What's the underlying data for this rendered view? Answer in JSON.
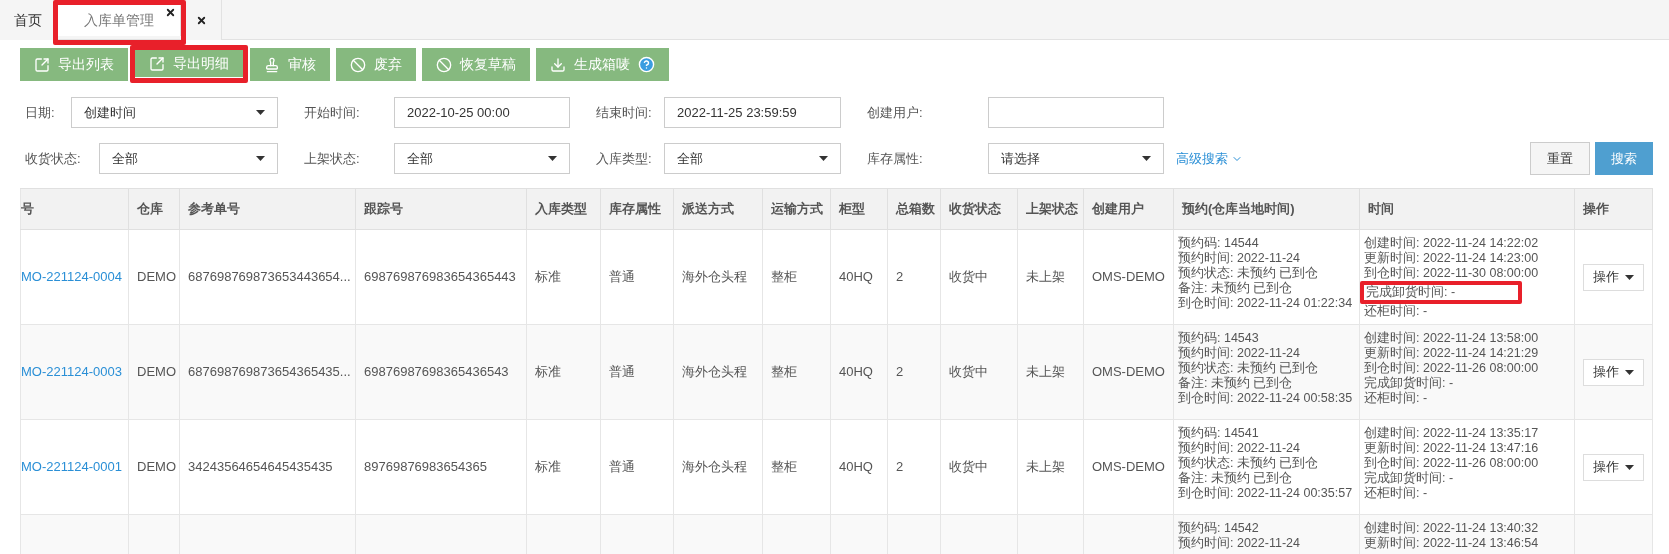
{
  "tabs": [
    {
      "label": "首页",
      "selected": false,
      "closable": false,
      "highlighted": false
    },
    {
      "label": "入库单管理",
      "selected": true,
      "closable": true,
      "highlighted": true
    },
    {
      "selected": false,
      "closable": true,
      "highlighted": false
    }
  ],
  "toolbar": [
    {
      "label": "导出列表",
      "kind": "export",
      "help": false,
      "highlighted": false
    },
    {
      "label": "导出明细",
      "kind": "export",
      "help": false,
      "highlighted": true
    },
    {
      "label": "审核",
      "kind": "stamp",
      "help": false,
      "highlighted": false
    },
    {
      "label": "废弃",
      "kind": "ban",
      "help": false,
      "highlighted": false
    },
    {
      "label": "恢复草稿",
      "kind": "ban",
      "help": false,
      "highlighted": false
    },
    {
      "label": "生成箱唛",
      "kind": "download",
      "help": true,
      "highlighted": false
    }
  ],
  "filters": [
    [
      {
        "label": "日期:",
        "kind": "select",
        "value": "创建时间"
      },
      {
        "label": "开始时间:",
        "kind": "input",
        "value": "2022-10-25 00:00"
      },
      {
        "label": "结束时间:",
        "kind": "input",
        "value": "2022-11-25 23:59:59"
      },
      {
        "label": "创建用户:",
        "kind": "input"
      }
    ],
    [
      {
        "label": "收货状态:",
        "kind": "select",
        "value": "全部"
      },
      {
        "label": "上架状态:",
        "kind": "select",
        "value": "全部"
      },
      {
        "label": "入库类型:",
        "kind": "select",
        "value": "全部"
      },
      {
        "label": "库存属性:",
        "kind": "select",
        "value": "请选择"
      }
    ]
  ],
  "advanced_search": "高级搜索",
  "reset_button": "重置",
  "search_button": "搜索",
  "table": {
    "columns": [
      "号",
      "仓库",
      "参考单号",
      "跟踪号",
      "入库类型",
      "库存属性",
      "派送方式",
      "运输方式",
      "柜型",
      "总箱数",
      "收货状态",
      "上架状态",
      "创建用户",
      "预约(仓库当地时间)",
      "时间",
      "操作"
    ],
    "rows": [
      {
        "order_no": "MO-221124-0004",
        "warehouse": "DEMO",
        "ref_no": "687698769873653443654...",
        "tracking_no": "698769876983654365443",
        "inbound_type": "标准",
        "stock_attr": "普通",
        "delivery": "海外仓头程",
        "transport": "整柜",
        "container": "40HQ",
        "boxes": "2",
        "receive_status": "收货中",
        "shelf_status": "未上架",
        "creator": "OMS-DEMO",
        "booking": [
          "预约码: 14544",
          "预约时间: 2022-11-24",
          "预约状态: 未预约 已到仓",
          "备注: 未预约 已到仓",
          "到仓时间: 2022-11-24 01:22:34"
        ],
        "times": [
          "创建时间: 2022-11-24 14:22:02",
          "更新时间: 2022-11-24 14:23:00",
          "到仓时间: 2022-11-30 08:00:00",
          {
            "text": "完成卸货时间: -",
            "highlighted": true
          },
          "还柜时间: -"
        ],
        "action": "操作"
      },
      {
        "order_no": "MO-221124-0003",
        "warehouse": "DEMO",
        "ref_no": "687698769873654365435...",
        "tracking_no": "69876987698365436543",
        "inbound_type": "标准",
        "stock_attr": "普通",
        "delivery": "海外仓头程",
        "transport": "整柜",
        "container": "40HQ",
        "boxes": "2",
        "receive_status": "收货中",
        "shelf_status": "未上架",
        "creator": "OMS-DEMO",
        "booking": [
          "预约码: 14543",
          "预约时间: 2022-11-24",
          "预约状态: 未预约 已到仓",
          "备注: 未预约 已到仓",
          "到仓时间: 2022-11-24 00:58:35"
        ],
        "times": [
          "创建时间: 2022-11-24 13:58:00",
          "更新时间: 2022-11-24 14:21:29",
          "到仓时间: 2022-11-26 08:00:00",
          "完成卸货时间: -",
          "还柜时间: -"
        ],
        "action": "操作"
      },
      {
        "order_no": "MO-221124-0001",
        "warehouse": "DEMO",
        "ref_no": "34243564654645435435",
        "tracking_no": "89769876983654365",
        "inbound_type": "标准",
        "stock_attr": "普通",
        "delivery": "海外仓头程",
        "transport": "整柜",
        "container": "40HQ",
        "boxes": "2",
        "receive_status": "收货中",
        "shelf_status": "未上架",
        "creator": "OMS-DEMO",
        "booking": [
          "预约码: 14541",
          "预约时间: 2022-11-24",
          "预约状态: 未预约 已到仓",
          "备注: 未预约 已到仓",
          "到仓时间: 2022-11-24 00:35:57"
        ],
        "times": [
          "创建时间: 2022-11-24 13:35:17",
          "更新时间: 2022-11-24 13:47:16",
          "到仓时间: 2022-11-26 08:00:00",
          "完成卸货时间: -",
          "还柜时间: -"
        ],
        "action": "操作"
      },
      {
        "booking": [
          "预约码: 14542",
          "预约时间: 2022-11-24"
        ],
        "times": [
          "创建时间: 2022-11-24 13:40:32",
          "更新时间: 2022-11-24 13:46:54"
        ]
      }
    ]
  }
}
